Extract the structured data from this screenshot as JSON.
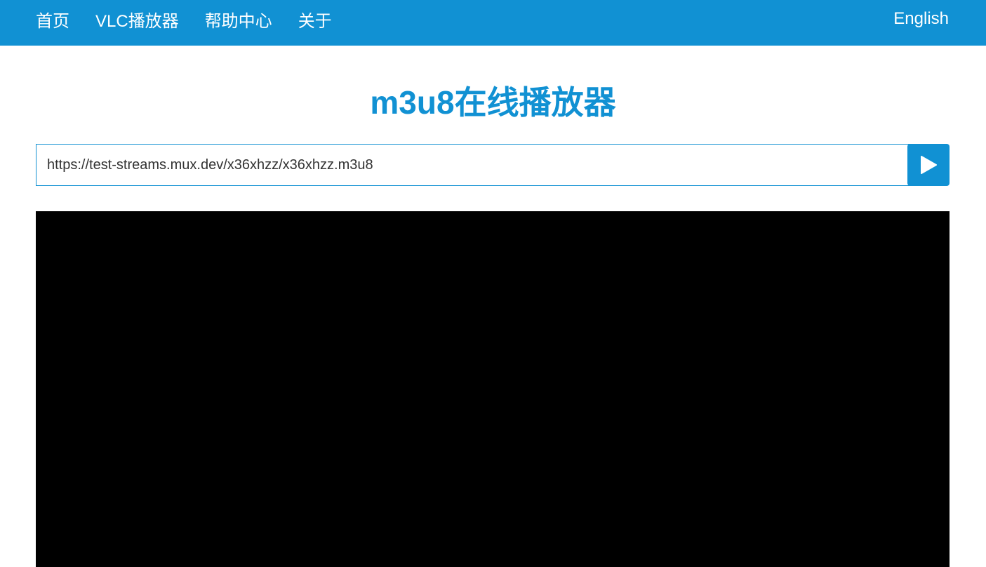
{
  "nav": {
    "items": [
      {
        "label": "首页"
      },
      {
        "label": "VLC播放器"
      },
      {
        "label": "帮助中心"
      },
      {
        "label": "关于"
      }
    ],
    "language_link": "English"
  },
  "page": {
    "title": "m3u8在线播放器"
  },
  "url_input": {
    "value": "https://test-streams.mux.dev/x36xhzz/x36xhzz.m3u8"
  },
  "play_button": {
    "icon": "play-icon"
  },
  "colors": {
    "brand": "#1191d3",
    "player_background": "#000000"
  }
}
